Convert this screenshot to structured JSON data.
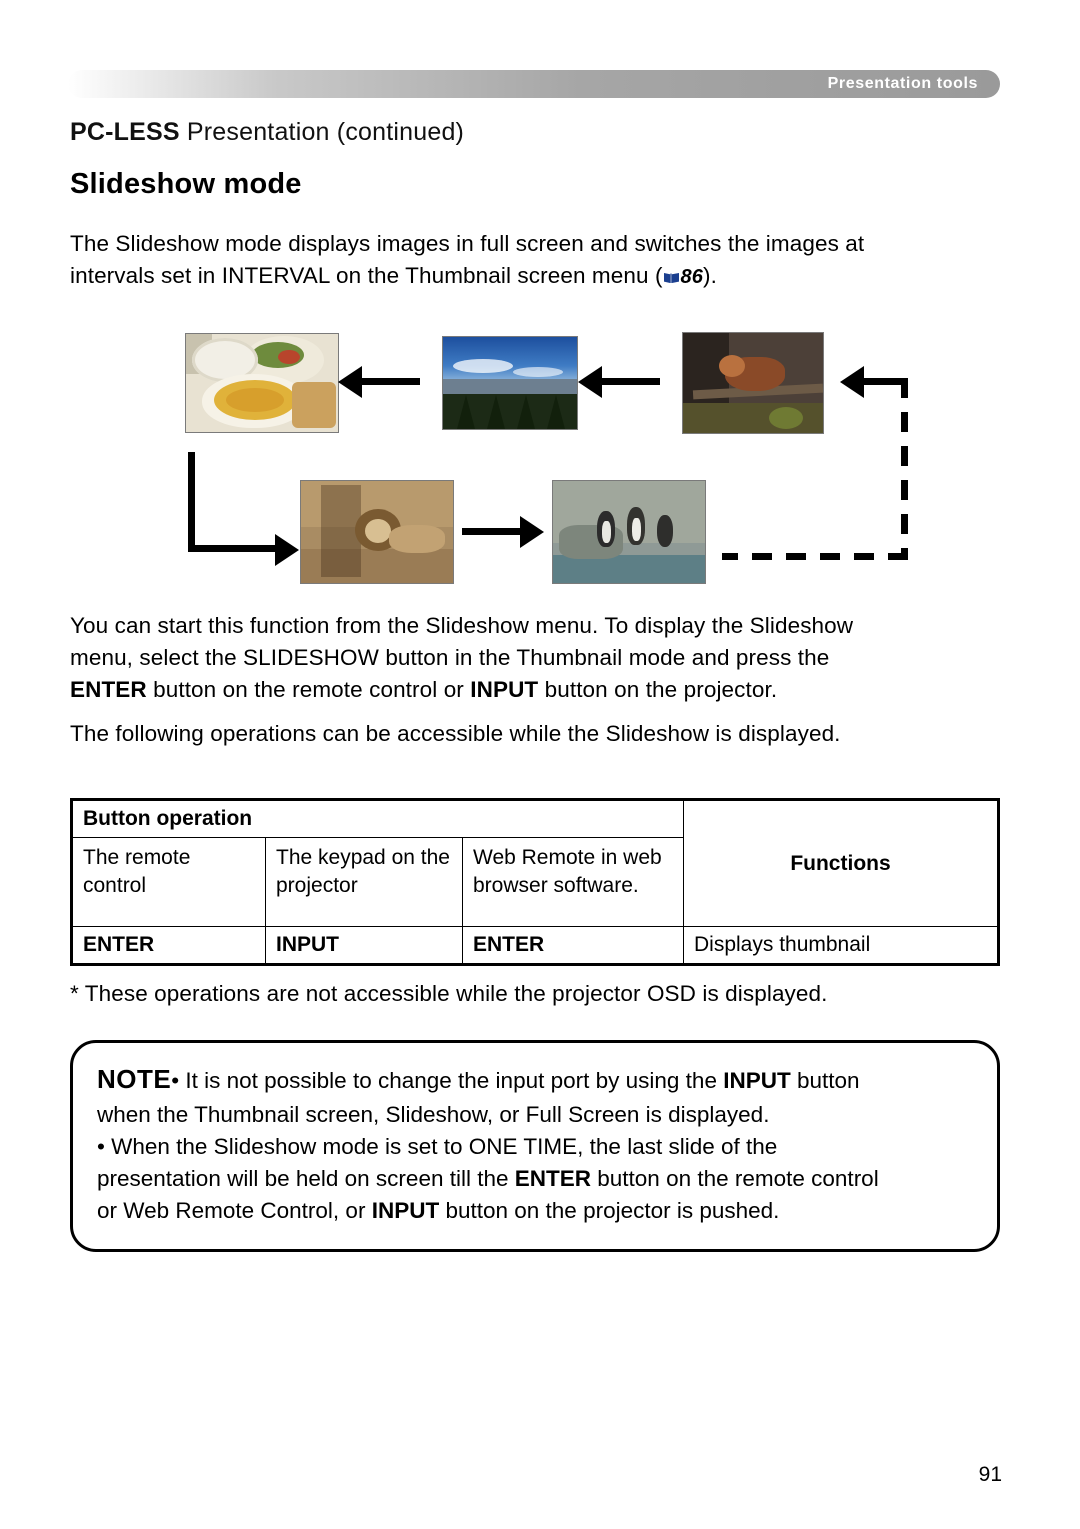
{
  "header": {
    "tab_label": "Presentation tools"
  },
  "running_title": {
    "bold": "PC-LESS",
    "rest": " Presentation (continued)"
  },
  "section_title": "Slideshow mode",
  "intro_paragraph": {
    "line1": "The Slideshow mode displays images in full screen and switches the images at",
    "line2_a": "intervals set in INTERVAL on the Thumbnail screen menu (",
    "page_ref": "86",
    "line2_b": ")."
  },
  "figure": {
    "caption_hidden": "Slideshow image rotation diagram",
    "photos": [
      {
        "name": "photo-food",
        "alt": "plate of food"
      },
      {
        "name": "photo-sky",
        "alt": "sky and mountain"
      },
      {
        "name": "photo-red-panda",
        "alt": "red panda on branch"
      },
      {
        "name": "photo-lion",
        "alt": "lion on rocks"
      },
      {
        "name": "photo-penguins",
        "alt": "penguins on rocks"
      }
    ]
  },
  "mid_paragraph": {
    "line1": "You can start this function from the Slideshow menu. To display the Slideshow",
    "line2": "menu, select the SLIDESHOW button in the Thumbnail mode and press the",
    "line3_a": "ENTER",
    "line3_b": " button on the remote control or ",
    "line3_c": "INPUT",
    "line3_d": " button on the projector."
  },
  "operations_paragraph": "The following operations can be accessible while the Slideshow is displayed.",
  "table": {
    "group_header": "Button operation",
    "functions_header": "Functions",
    "subheaders": {
      "remote": "The remote control",
      "keypad": "The keypad on the projector",
      "web": "Web Remote in web browser software."
    },
    "rows": [
      {
        "remote": "ENTER",
        "keypad": "INPUT",
        "web": "ENTER",
        "function": "Displays thumbnail"
      }
    ]
  },
  "footnote": "* These operations are not accessible while the projector OSD is displayed.",
  "note": {
    "label": "NOTE",
    "line1_a": "• It is not possible to change the input port by using the ",
    "line1_bold": "INPUT",
    "line1_b": " button",
    "line2": "when the Thumbnail screen, Slideshow, or Full Screen is displayed.",
    "line3": "• When the Slideshow mode is set to ONE TIME, the last slide of the",
    "line4_a": "presentation will be held on screen till the ",
    "line4_bold": "ENTER",
    "line4_b": " button on the remote control",
    "line5_a": "or Web Remote Control, or ",
    "line5_bold": "INPUT",
    "line5_b": " button on the projector is pushed."
  },
  "page_number": "91"
}
